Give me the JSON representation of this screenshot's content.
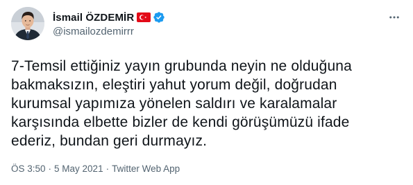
{
  "user": {
    "display_name": "İsmail ÖZDEMİR",
    "handle": "@ismailozdemirrr",
    "flag_icon": "turkey-flag-icon",
    "verified_icon": "verified-badge-icon"
  },
  "tweet": {
    "text": "7-Temsil ettiğiniz yayın grubunda neyin ne olduğuna\nbakmaksızın, eleştiri yahut yorum değil, doğrudan\nkurumsal yapımıza yönelen saldırı ve karalamalar\nkarşısında elbette bizler de kendi görüşümüzü ifade\nederiz, bundan geri durmayız."
  },
  "meta": {
    "time": "ÖS 3:50",
    "separator": "·",
    "date": "5 May 2021",
    "source": "Twitter Web App"
  },
  "colors": {
    "brand_blue": "#1d9bf0",
    "flag_red": "#e30a17",
    "secondary_text": "#536471"
  }
}
